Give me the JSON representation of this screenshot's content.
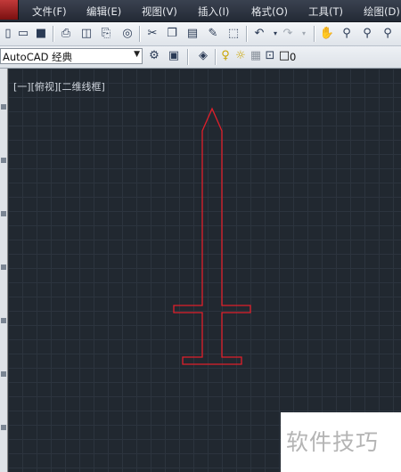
{
  "menu": {
    "items": [
      "文件(F)",
      "编辑(E)",
      "视图(V)",
      "插入(I)",
      "格式(O)",
      "工具(T)",
      "绘图(D)"
    ]
  },
  "toolbar": {
    "icons": [
      "new-file-icon",
      "open-folder-icon",
      "save-icon",
      "plot-icon",
      "plot-preview-icon",
      "publish-icon",
      "3d-dwf-icon",
      "cut-icon",
      "copy-icon",
      "paste-icon",
      "match-properties-icon",
      "block-editor-icon",
      "undo-icon",
      "redo-icon",
      "pan-icon",
      "zoom-realtime-icon",
      "zoom-window-icon",
      "zoom-previous-icon"
    ]
  },
  "workspace": {
    "selected": "AutoCAD 经典"
  },
  "layer": {
    "current": "0",
    "icons": [
      "layer-states-icon",
      "bulb-on-icon",
      "sun-icon",
      "layer-lock-icon",
      "unlock-icon",
      "color-square-icon"
    ]
  },
  "viewport": {
    "label": "[一][俯视][二维线框]"
  },
  "drawing": {
    "shape": "sword",
    "stroke_color": "#e01f2a",
    "background_color": "#212830",
    "grid_color": "#2c343e"
  },
  "watermark": {
    "text": "软件技巧"
  }
}
